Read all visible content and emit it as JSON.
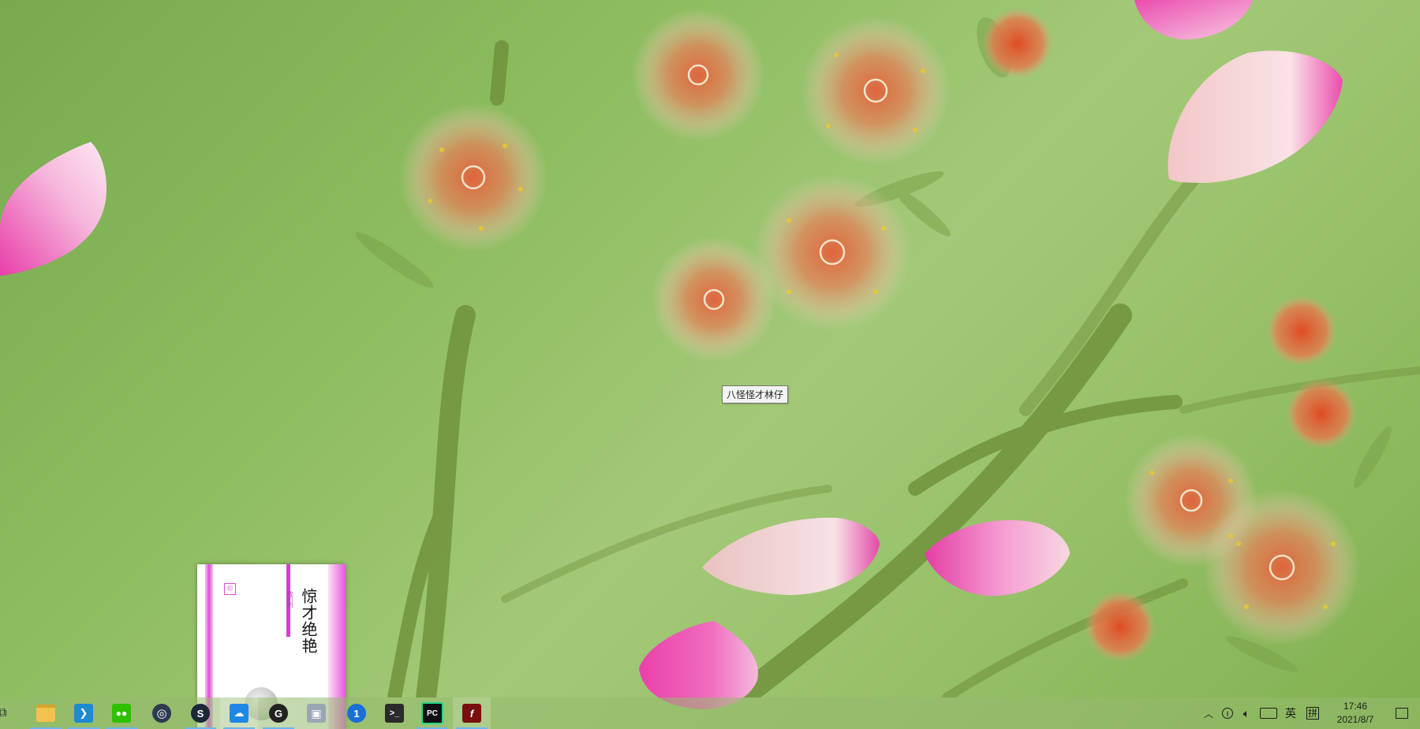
{
  "desktop": {
    "tooltip": "八怪怪才林仔"
  },
  "preview": {
    "book_title": "惊才绝艳",
    "book_subtitle": "我们的…"
  },
  "taskbar": {
    "items": [
      {
        "name": "task-view",
        "icon": "task-view-icon",
        "color": "#2b2b2b"
      },
      {
        "name": "file-explorer",
        "icon": "folder-icon",
        "color": "#f2c14e"
      },
      {
        "name": "vscode",
        "icon": "vscode-icon",
        "color": "#1f8ad2"
      },
      {
        "name": "wechat",
        "icon": "wechat-icon",
        "color": "#2dc100"
      },
      {
        "name": "app-ring",
        "icon": "ring-icon",
        "color": "#2d3a52"
      },
      {
        "name": "steam",
        "icon": "steam-icon",
        "color": "#1b2838"
      },
      {
        "name": "app-blue",
        "icon": "cloud-icon",
        "color": "#1e88e5"
      },
      {
        "name": "app-g",
        "icon": "g-icon",
        "color": "#222222"
      },
      {
        "name": "photos",
        "icon": "photos-icon",
        "color": "#9aa6b2"
      },
      {
        "name": "1password",
        "icon": "key-icon",
        "color": "#1a6fd6"
      },
      {
        "name": "terminal",
        "icon": "terminal-icon",
        "color": "#2b2b2b"
      },
      {
        "name": "pycharm",
        "icon": "pycharm-icon",
        "color": "#21d789"
      },
      {
        "name": "flash",
        "icon": "flash-icon",
        "color": "#7a0f0f"
      }
    ],
    "tray": {
      "ime_lang": "英",
      "ime_mode": "拼",
      "time": "17:46",
      "date": "2021/8/7"
    }
  }
}
